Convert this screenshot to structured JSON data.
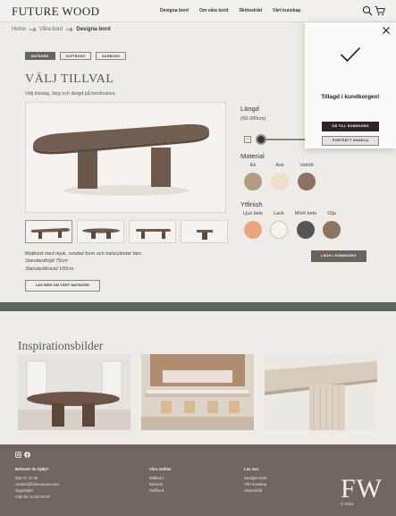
{
  "header": {
    "logo": "FUTURE WOOD",
    "nav": [
      "Designa bord",
      "Om våra bord",
      "Skötselråd",
      "Vårt kunskap"
    ],
    "icons": [
      "search-icon",
      "cart-icon"
    ]
  },
  "breadcrumb": [
    "Home",
    "Våra bord",
    "Designa bord"
  ],
  "tabs": [
    "MATBORD",
    "SOFFBORD",
    "BARBORD"
  ],
  "product": {
    "title": "VÄLJ TILLVAL",
    "subtitle": "Välj träslag, färg och längd på bordsskiva",
    "description": [
      "Matbord med mjuk, rundad form och halvcylinder ben.",
      "Standardhöjd 75cm",
      "Standardbredd 100cm"
    ],
    "learn_more": "LÄS MER OM VÅRT MATBORD"
  },
  "options": {
    "length_label": "Längd",
    "length_range": "(50-300cm)",
    "material_label": "Material",
    "materials": [
      {
        "name": "Ek",
        "color": "#b39b82"
      },
      {
        "name": "Ask",
        "color": "#f2dfca"
      },
      {
        "name": "Valnöt",
        "color": "#8b7262"
      }
    ],
    "finish_label": "Ytfinish",
    "finishes": [
      {
        "name": "Ljus bets",
        "color": "#eda57d"
      },
      {
        "name": "Lack",
        "color": "#f7f3ec"
      },
      {
        "name": "Mörk bets",
        "color": "#595452"
      },
      {
        "name": "Olja",
        "color": "#8a7567"
      }
    ],
    "add_to_cart": "LÄGG I KUNDKORG"
  },
  "inspiration": {
    "title": "Inspirationsbilder"
  },
  "footer": {
    "help_title": "Behöver du hjälp?",
    "help_lines": [
      "032-47 47 90",
      "contact@futurewood.com",
      "Öppettider",
      "mån-fre 10.00-20.00"
    ],
    "furniture_title": "Våra möbler",
    "furniture_lines": [
      "Matbord",
      "Barbord",
      "Soffbord"
    ],
    "learn_title": "Läs mer",
    "learn_lines": [
      "Designa bord",
      "Vårt kunskap",
      "Skötselråd"
    ],
    "monogram": "FW",
    "copyright": "© 2024"
  },
  "popup": {
    "message": "Tillagd i kundkorgen!",
    "primary": "GÅ TILL KUNDKORG",
    "secondary": "FORTSÄTT HANDLA"
  }
}
